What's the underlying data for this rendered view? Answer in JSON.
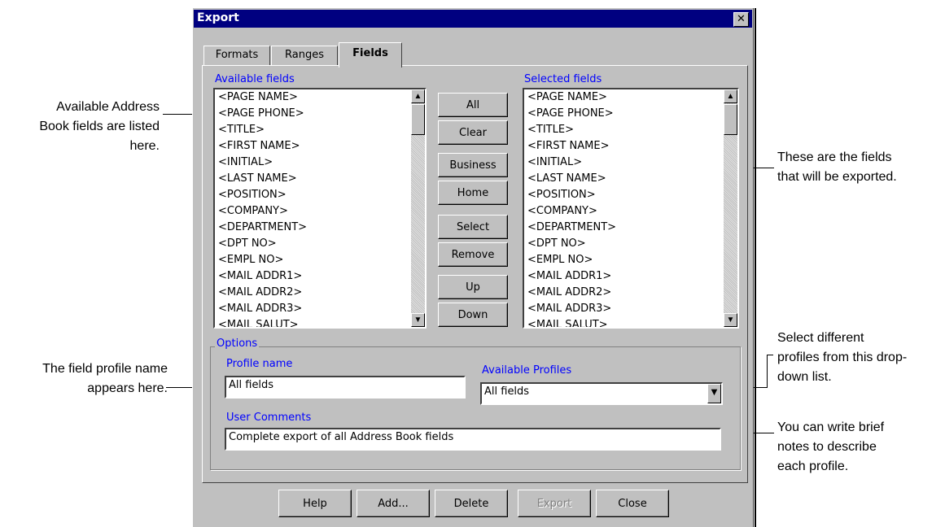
{
  "dialog": {
    "title": "Export",
    "close_icon": "close-icon",
    "tabs": [
      {
        "label": "Formats"
      },
      {
        "label": "Ranges"
      },
      {
        "label": "Fields",
        "active": true
      }
    ]
  },
  "fields": {
    "available_label": "Available fields",
    "selected_label": "Selected fields",
    "available_items": [
      "<PAGE NAME>",
      "<PAGE PHONE>",
      "<TITLE>",
      "<FIRST NAME>",
      "<INITIAL>",
      "<LAST NAME>",
      "<POSITION>",
      "<COMPANY>",
      "<DEPARTMENT>",
      "<DPT NO>",
      "<EMPL NO>",
      "<MAIL ADDR1>",
      "<MAIL ADDR2>",
      "<MAIL ADDR3>",
      "<MAIL SALUT>"
    ],
    "selected_items": [
      "<PAGE NAME>",
      "<PAGE PHONE>",
      "<TITLE>",
      "<FIRST NAME>",
      "<INITIAL>",
      "<LAST NAME>",
      "<POSITION>",
      "<COMPANY>",
      "<DEPARTMENT>",
      "<DPT NO>",
      "<EMPL NO>",
      "<MAIL ADDR1>",
      "<MAIL ADDR2>",
      "<MAIL ADDR3>",
      "<MAIL SALUT>"
    ],
    "buttons": [
      "All",
      "Clear",
      "Business",
      "Home",
      "Select",
      "Remove",
      "Up",
      "Down"
    ]
  },
  "options": {
    "group_title": "Options",
    "profile_name_label": "Profile name",
    "profile_name_value": "All fields",
    "available_profiles_label": "Available Profiles",
    "available_profiles_value": "All fields",
    "user_comments_label": "User Comments",
    "user_comments_value": "Complete export of all Address Book fields"
  },
  "footer_buttons": [
    {
      "label": "Help",
      "disabled": false
    },
    {
      "label": "Add...",
      "disabled": false
    },
    {
      "label": "Delete",
      "disabled": false
    },
    {
      "label": "Export",
      "disabled": true
    },
    {
      "label": "Close",
      "disabled": false
    }
  ],
  "annotations": {
    "available": [
      "Available Address",
      "Book fields are listed",
      "here."
    ],
    "selected": [
      "These are the fields",
      "that will be exported."
    ],
    "profile_name": [
      "The field profile name",
      "appears here."
    ],
    "profiles": [
      "Select different",
      "profiles from this drop-",
      "down list."
    ],
    "comments": [
      "You can write brief",
      "notes to describe",
      "each profile."
    ]
  },
  "colors": {
    "titlebar": "#000080",
    "face": "#c0c0c0",
    "label_text": "#0000ff"
  }
}
